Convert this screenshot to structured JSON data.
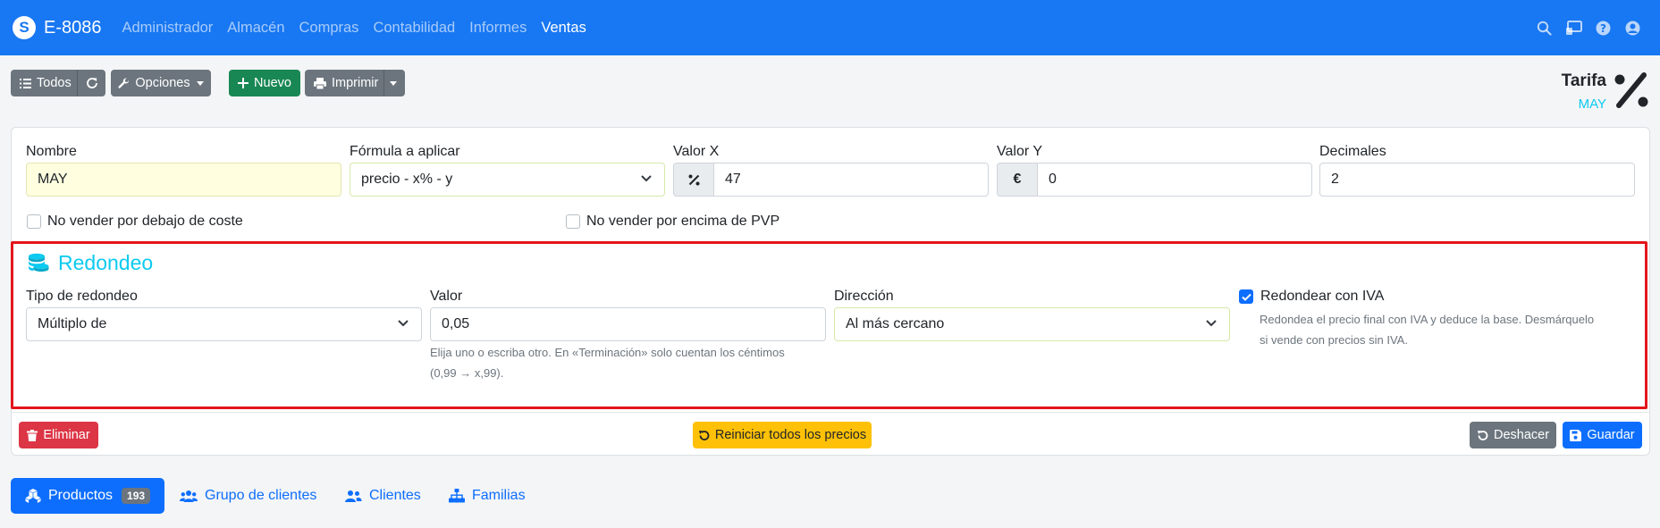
{
  "navbar": {
    "brand": "E-8086",
    "menu": [
      "Administrador",
      "Almacén",
      "Compras",
      "Contabilidad",
      "Informes",
      "Ventas"
    ],
    "active": "Ventas",
    "icons": [
      "search-icon",
      "screen-icon",
      "help-icon",
      "user-icon"
    ]
  },
  "toolbar": {
    "all": "Todos",
    "options": "Opciones",
    "new": "Nuevo",
    "print": "Imprimir"
  },
  "header": {
    "title": "Tarifa",
    "subtitle": "MAY"
  },
  "form": {
    "name_label": "Nombre",
    "name_value": "MAY",
    "formula_label": "Fórmula a aplicar",
    "formula_value": "precio - x% - y",
    "valx_label": "Valor X",
    "valx_addon": "%",
    "valx_value": "47",
    "valy_label": "Valor Y",
    "valy_addon": "€",
    "valy_value": "0",
    "decimals_label": "Decimales",
    "decimals_value": "2",
    "no_below_cost": "No vender por debajo de coste",
    "no_above_pvp": "No vender por encima de PVP"
  },
  "rounding": {
    "title": "Redondeo",
    "type_label": "Tipo de redondeo",
    "type_value": "Múltiplo de",
    "value_label": "Valor",
    "value_value": "0,05",
    "value_help_1": "Elija uno o escriba otro. En «Terminación» solo cuentan los céntimos",
    "value_help_2": "(0,99 → x,99).",
    "direction_label": "Dirección",
    "direction_value": "Al más cercano",
    "vat_label": "Redondear con IVA",
    "vat_checked": true,
    "vat_help_1": "Redondea el precio final con IVA y deduce la base. Desmárquelo",
    "vat_help_2": "si vende con precios sin IVA."
  },
  "actions": {
    "delete": "Eliminar",
    "reset": "Reiniciar todos los precios",
    "undo": "Deshacer",
    "save": "Guardar"
  },
  "tabs": [
    {
      "label": "Productos",
      "badge": "193"
    },
    {
      "label": "Grupo de clientes"
    },
    {
      "label": "Clientes"
    },
    {
      "label": "Familias"
    }
  ],
  "colors": {
    "primary": "#1877f2",
    "accent": "#0dcaf0",
    "danger": "#dc3545",
    "highlight": "#e3161b"
  }
}
